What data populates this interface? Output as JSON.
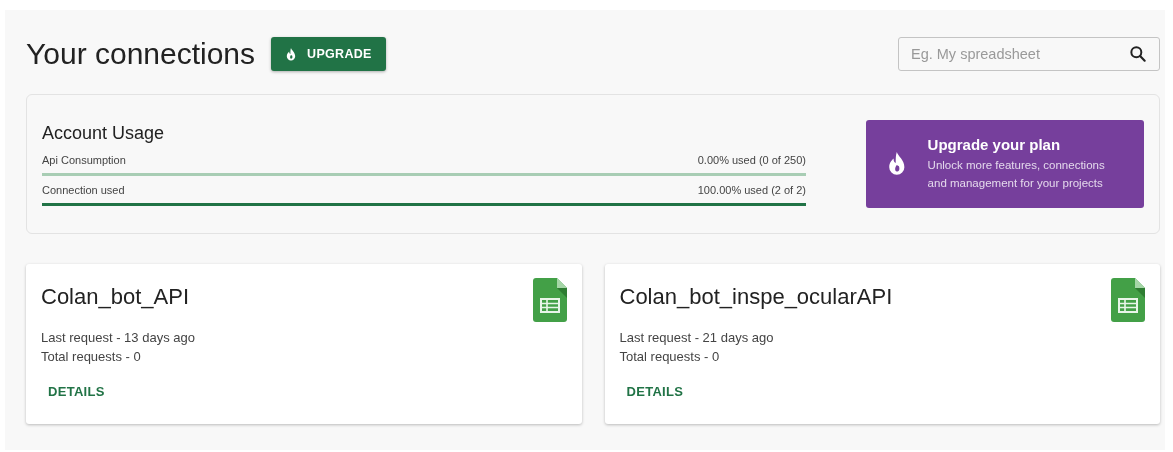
{
  "header": {
    "title": "Your connections",
    "upgrade_button": "UPGRADE",
    "search": {
      "placeholder": "Eg. My spreadsheet"
    }
  },
  "usage": {
    "title": "Account Usage",
    "meters": [
      {
        "label": "Api Consumption",
        "reading": "0.00% used (0 of 250)",
        "level": 0
      },
      {
        "label": "Connection used",
        "reading": "100.00% used (2 of 2)",
        "level": 1
      }
    ],
    "promo": {
      "title": "Upgrade your plan",
      "text": "Unlock more features, connections and management for your projects"
    }
  },
  "connections": [
    {
      "name": "Colan_bot_API",
      "last_request": "Last request - 13 days ago",
      "total_requests": "Total requests - 0",
      "action": "DETAILS"
    },
    {
      "name": "Colan_bot_inspe_ocularAPI",
      "last_request": "Last request - 21 days ago",
      "total_requests": "Total requests - 0",
      "action": "DETAILS"
    }
  ]
}
